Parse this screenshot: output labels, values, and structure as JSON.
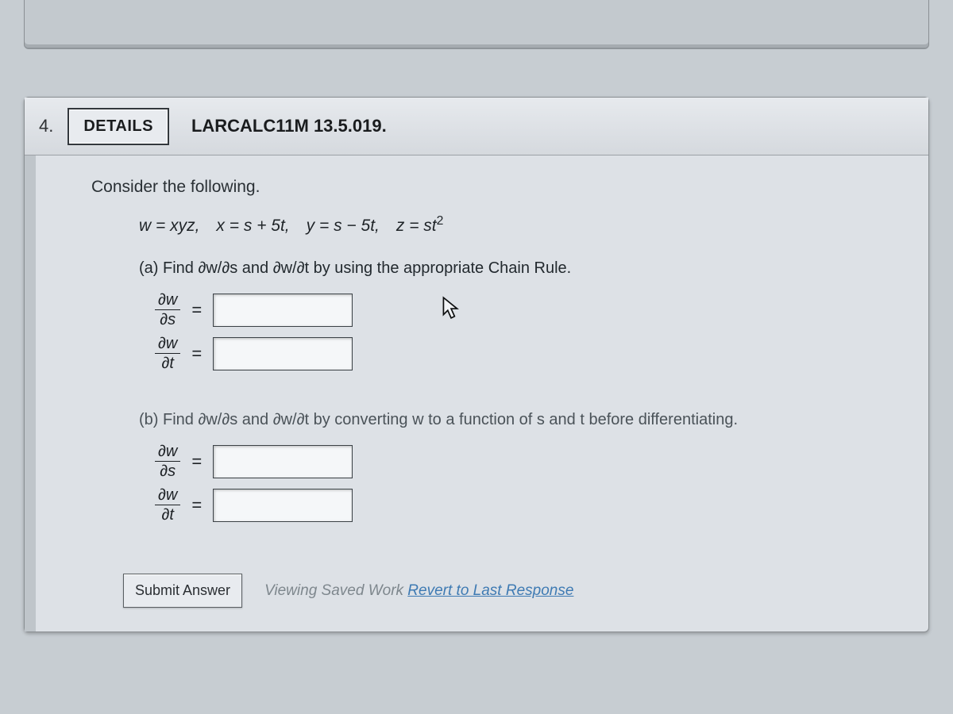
{
  "question_number": "4.",
  "details_button": "DETAILS",
  "question_code": "LARCALC11M 13.5.019.",
  "intro": "Consider the following.",
  "given_html": "w = xyz, x = s + 5t, y = s − 5t, z = st",
  "given_exp": "2",
  "part_a": "(a) Find ∂w/∂s and ∂w/∂t by using the appropriate Chain Rule.",
  "part_b": "(b) Find ∂w/∂s and ∂w/∂t by converting w to a function of s and t before differentiating.",
  "fractions": {
    "dw": "∂w",
    "ds": "∂s",
    "dt": "∂t"
  },
  "equals": "=",
  "submit": "Submit Answer",
  "saved_prefix": "Viewing Saved Work ",
  "revert": "Revert to Last Response"
}
